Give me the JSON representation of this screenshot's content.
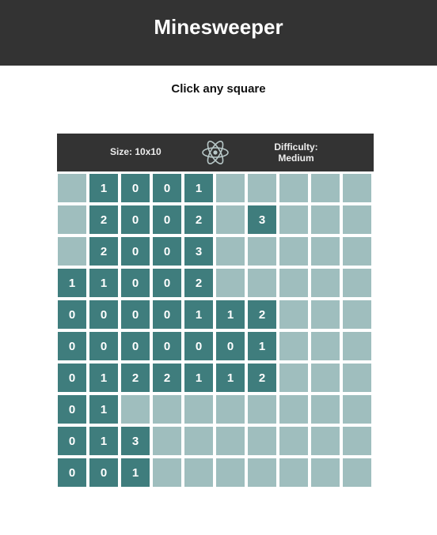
{
  "header": {
    "title": "Minesweeper"
  },
  "status": {
    "message": "Click any square"
  },
  "info_bar": {
    "size_label": "Size: 10x10",
    "difficulty_label": "Difficulty:",
    "difficulty_value": "Medium",
    "center_icon": "atom-icon"
  },
  "board": {
    "rows": 10,
    "cols": 10,
    "colors": {
      "hidden": "#9fbebe",
      "revealed": "#3f7d7d",
      "header_bg": "#333333"
    },
    "cells": [
      [
        "h",
        "1",
        "0",
        "0",
        "1",
        "h",
        "h",
        "h",
        "h",
        "h"
      ],
      [
        "h",
        "2",
        "0",
        "0",
        "2",
        "h",
        "3",
        "h",
        "h",
        "h"
      ],
      [
        "h",
        "2",
        "0",
        "0",
        "3",
        "h",
        "h",
        "h",
        "h",
        "h"
      ],
      [
        "1",
        "1",
        "0",
        "0",
        "2",
        "h",
        "h",
        "h",
        "h",
        "h"
      ],
      [
        "0",
        "0",
        "0",
        "0",
        "1",
        "1",
        "2",
        "h",
        "h",
        "h"
      ],
      [
        "0",
        "0",
        "0",
        "0",
        "0",
        "0",
        "1",
        "h",
        "h",
        "h"
      ],
      [
        "0",
        "1",
        "2",
        "2",
        "1",
        "1",
        "2",
        "h",
        "h",
        "h"
      ],
      [
        "0",
        "1",
        "h",
        "h",
        "h",
        "h",
        "h",
        "h",
        "h",
        "h"
      ],
      [
        "0",
        "1",
        "3",
        "h",
        "h",
        "h",
        "h",
        "h",
        "h",
        "h"
      ],
      [
        "0",
        "0",
        "1",
        "h",
        "h",
        "h",
        "h",
        "h",
        "h",
        "h"
      ]
    ]
  }
}
